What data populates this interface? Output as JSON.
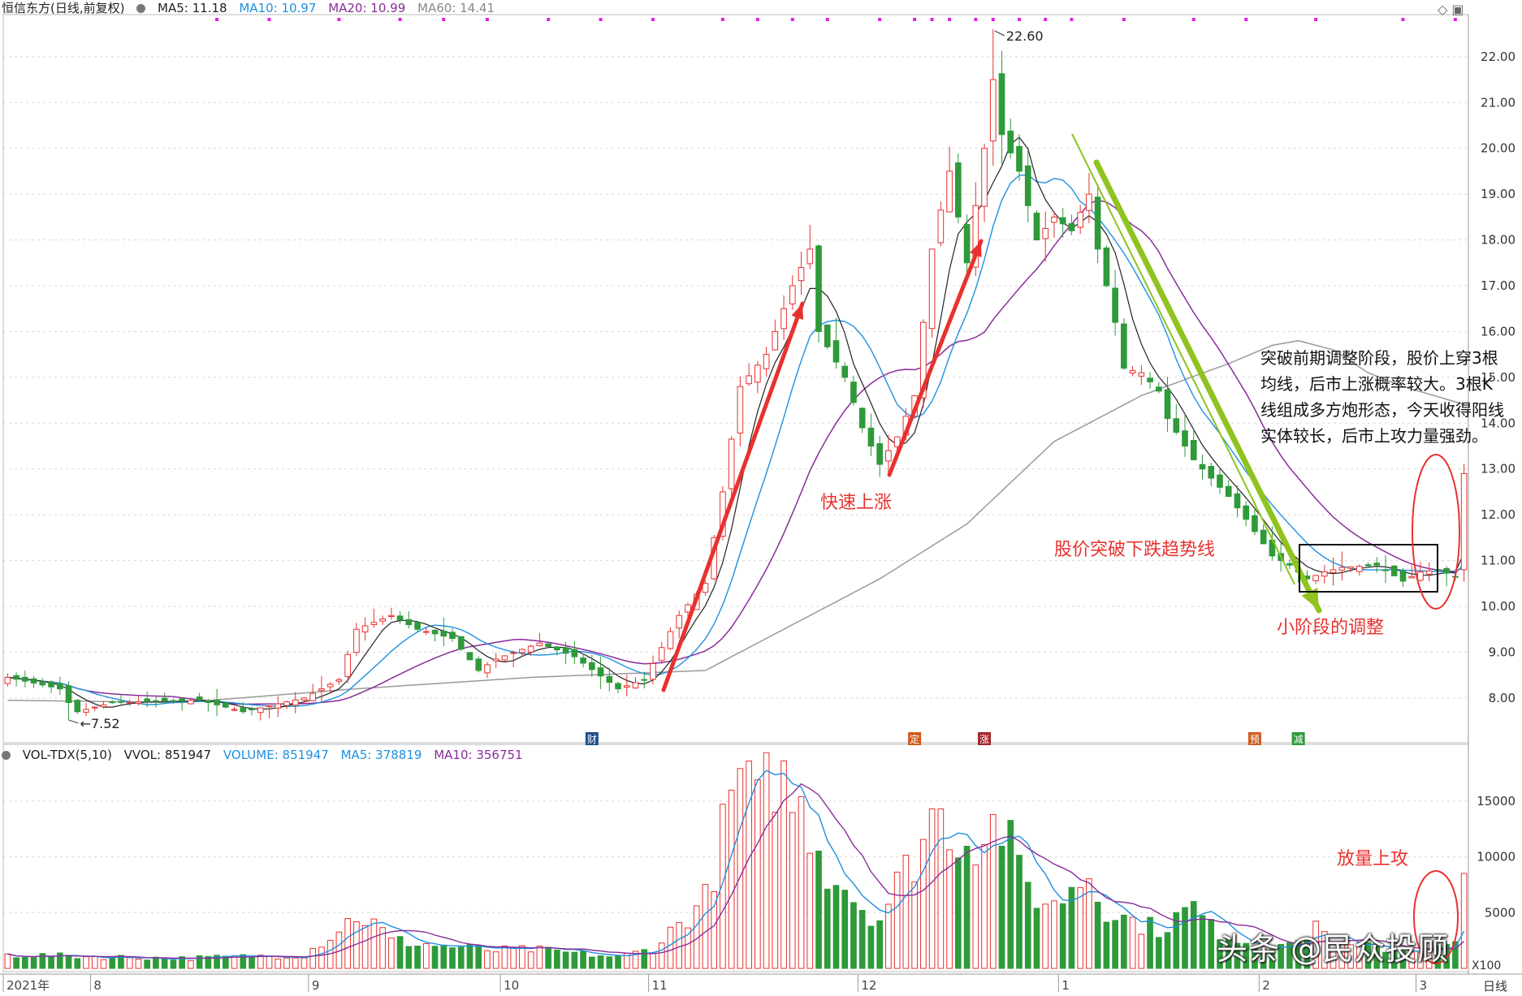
{
  "header": {
    "title": "恒信东方(日线,前复权)",
    "ma5": "MA5: 11.18",
    "ma10": "MA10: 10.97",
    "ma20": "MA20: 10.99",
    "ma60": "MA60: 14.41"
  },
  "vol_header": {
    "title": "VOL-TDX(5,10)",
    "vvol": "VVOL: 851947",
    "volume": "VOLUME: 851947",
    "ma5": "MA5: 378819",
    "ma10": "MA10: 356751"
  },
  "annotations": {
    "rapid_rise": "快速上涨",
    "break_trendline": "股价突破下跌趋势线",
    "small_adjust": "小阶段的调整",
    "volume_attack": "放量上攻",
    "note": "突破前期调整阶段，股价上穿3根均线，后市上涨概率较大。3根K线组成多方炮形态，今天收得阳线实体较长，后市上攻力量强劲。",
    "high_label": "22.60",
    "low_label": "7.52"
  },
  "watermark": "头条 @民众投顾",
  "period_label": "日线",
  "vol_unit": "X100",
  "markers": [
    "财",
    "定",
    "涨",
    "预",
    "减"
  ],
  "colors": {
    "up": "#e8312f",
    "down": "#2e9a3a",
    "ma5": "#222222",
    "ma10": "#1e90e0",
    "ma20": "#8a2c9a",
    "ma60": "#9a9a9a",
    "arrow_red": "#e8312f",
    "arrow_green": "#8fc31f",
    "grid": "#d8d8d8"
  },
  "chart_data": [
    {
      "type": "candlestick",
      "ylim": [
        7.2,
        22.6
      ],
      "yticks": [
        8.0,
        9.0,
        10.0,
        11.0,
        12.0,
        13.0,
        14.0,
        15.0,
        16.0,
        17.0,
        18.0,
        19.0,
        20.0,
        21.0,
        22.0
      ],
      "x_labels": [
        {
          "label": "2021年",
          "idx": 0
        },
        {
          "label": "8",
          "idx": 10
        },
        {
          "label": "9",
          "idx": 35
        },
        {
          "label": "10",
          "idx": 57
        },
        {
          "label": "11",
          "idx": 74
        },
        {
          "label": "12",
          "idx": 98
        },
        {
          "label": "1",
          "idx": 121
        },
        {
          "label": "2",
          "idx": 144
        },
        {
          "label": "3",
          "idx": 162
        }
      ],
      "high": 22.6,
      "low": 7.52,
      "anchors": [
        [
          0,
          8.45
        ],
        [
          6,
          8.2
        ],
        [
          7,
          7.9
        ],
        [
          8,
          7.7
        ],
        [
          12,
          7.9
        ],
        [
          22,
          7.95
        ],
        [
          27,
          7.7
        ],
        [
          34,
          8.0
        ],
        [
          38,
          8.4
        ],
        [
          40,
          9.5
        ],
        [
          44,
          9.8
        ],
        [
          47,
          9.5
        ],
        [
          51,
          9.3
        ],
        [
          54,
          8.6
        ],
        [
          56,
          8.85
        ],
        [
          61,
          9.2
        ],
        [
          65,
          8.9
        ],
        [
          70,
          8.2
        ],
        [
          73,
          8.4
        ],
        [
          77,
          9.8
        ],
        [
          80,
          10.5
        ],
        [
          82,
          12.5
        ],
        [
          84,
          14.8
        ],
        [
          87,
          15.5
        ],
        [
          90,
          17.0
        ],
        [
          92,
          17.8
        ],
        [
          93,
          16.0
        ],
        [
          96,
          15.0
        ],
        [
          98,
          13.9
        ],
        [
          100,
          13.1
        ],
        [
          102,
          13.7
        ],
        [
          104,
          14.6
        ],
        [
          106,
          17.8
        ],
        [
          108,
          19.5
        ],
        [
          110,
          17.5
        ],
        [
          112,
          20.0
        ],
        [
          113,
          21.5
        ],
        [
          114,
          20.3
        ],
        [
          116,
          19.5
        ],
        [
          118,
          18.0
        ],
        [
          120,
          18.5
        ],
        [
          122,
          18.2
        ],
        [
          124,
          19.0
        ],
        [
          125,
          17.8
        ],
        [
          126,
          17.0
        ],
        [
          127,
          16.2
        ],
        [
          128,
          15.2
        ],
        [
          130,
          15.1
        ],
        [
          132,
          14.7
        ],
        [
          133,
          14.1
        ],
        [
          136,
          13.2
        ],
        [
          140,
          12.4
        ],
        [
          142,
          11.9
        ],
        [
          145,
          11.1
        ],
        [
          147,
          10.9
        ],
        [
          149,
          10.6
        ],
        [
          151,
          10.75
        ],
        [
          153,
          10.85
        ],
        [
          157,
          10.9
        ],
        [
          160,
          10.55
        ],
        [
          162,
          10.75
        ],
        [
          164,
          10.8
        ],
        [
          166,
          10.65
        ],
        [
          167,
          12.9
        ]
      ],
      "ma60_points": [
        [
          0,
          7.95
        ],
        [
          20,
          7.9
        ],
        [
          40,
          8.2
        ],
        [
          60,
          8.45
        ],
        [
          80,
          8.6
        ],
        [
          90,
          9.6
        ],
        [
          100,
          10.6
        ],
        [
          110,
          11.8
        ],
        [
          120,
          13.6
        ],
        [
          130,
          14.6
        ],
        [
          140,
          15.3
        ],
        [
          145,
          15.7
        ],
        [
          148,
          15.8
        ],
        [
          152,
          15.6
        ],
        [
          156,
          15.1
        ],
        [
          160,
          14.8
        ],
        [
          167,
          14.41
        ]
      ]
    },
    {
      "type": "bar",
      "series": "volume",
      "ylim": [
        0,
        19500
      ],
      "yticks": [
        5000,
        10000,
        15000
      ],
      "anchors": [
        [
          0,
          1200
        ],
        [
          20,
          900
        ],
        [
          34,
          1200
        ],
        [
          38,
          3500
        ],
        [
          40,
          4800
        ],
        [
          42,
          4000
        ],
        [
          44,
          2500
        ],
        [
          50,
          2000
        ],
        [
          56,
          1600
        ],
        [
          60,
          1700
        ],
        [
          70,
          1000
        ],
        [
          74,
          1800
        ],
        [
          77,
          4000
        ],
        [
          80,
          6200
        ],
        [
          82,
          12000
        ],
        [
          84,
          17500
        ],
        [
          86,
          14000
        ],
        [
          88,
          18000
        ],
        [
          90,
          15000
        ],
        [
          92,
          13000
        ],
        [
          94,
          9000
        ],
        [
          96,
          7500
        ],
        [
          98,
          5500
        ],
        [
          100,
          4500
        ],
        [
          102,
          7500
        ],
        [
          104,
          10000
        ],
        [
          106,
          13800
        ],
        [
          108,
          13000
        ],
        [
          110,
          11500
        ],
        [
          112,
          12500
        ],
        [
          114,
          13000
        ],
        [
          116,
          8500
        ],
        [
          118,
          6500
        ],
        [
          120,
          5500
        ],
        [
          122,
          7500
        ],
        [
          124,
          8500
        ],
        [
          126,
          5500
        ],
        [
          128,
          4500
        ],
        [
          132,
          3500
        ],
        [
          136,
          5500
        ],
        [
          138,
          3600
        ],
        [
          142,
          2400
        ],
        [
          144,
          1800
        ],
        [
          146,
          2600
        ],
        [
          148,
          2000
        ],
        [
          150,
          4200
        ],
        [
          152,
          2000
        ],
        [
          156,
          1900
        ],
        [
          160,
          1600
        ],
        [
          164,
          1800
        ],
        [
          166,
          2200
        ],
        [
          167,
          8519
        ]
      ]
    }
  ]
}
